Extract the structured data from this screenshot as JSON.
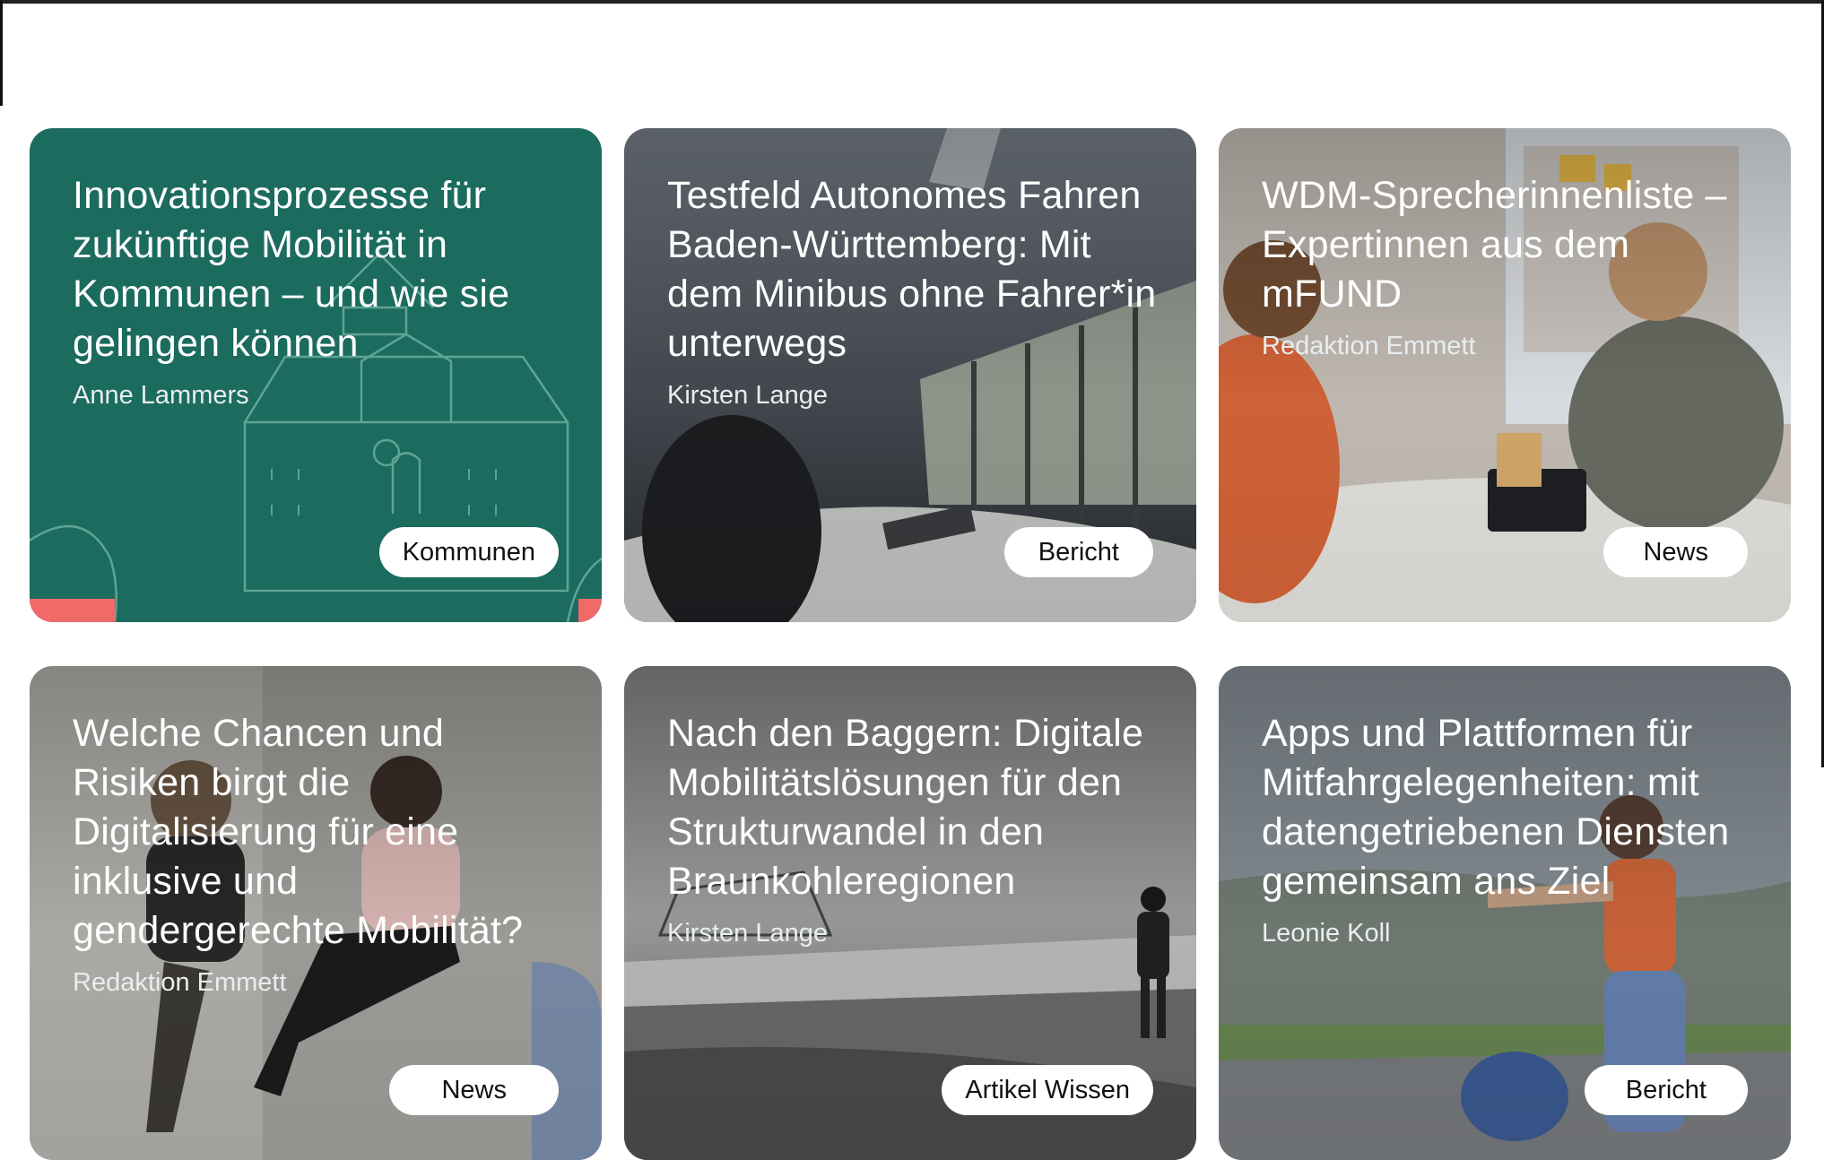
{
  "cards": [
    {
      "title": "Innovationsprozesse für zukünftige Mobilität in Kommunen – und wie sie gelingen können",
      "author": "Anne Lammers",
      "tag": "Kommunen",
      "bg": "#1c6b5f",
      "accent": "#f06a6a"
    },
    {
      "title": "Testfeld Autonomes Fahren Baden-Württemberg: Mit dem Minibus ohne Fahrer*in unterwegs",
      "author": "Kirsten Lange",
      "tag": "Bericht"
    },
    {
      "title": "WDM-Sprecherinnenliste – Expertinnen aus dem mFUND",
      "author": "Redaktion Emmett",
      "tag": "News"
    },
    {
      "title": "Welche Chancen und Risiken birgt die Digitalisierung für eine inklusive und gendergerechte Mobilität?",
      "author": "Redaktion Emmett",
      "tag": "News"
    },
    {
      "title": "Nach den Baggern: Digitale Mobilitätslösungen für den Strukturwandel in den Braunkohleregionen",
      "author": "Kirsten Lange",
      "tag": "Artikel Wissen"
    },
    {
      "title": "Apps und Plattformen für Mitfahrgelegenheiten: mit datengetriebenen Diensten gemeinsam ans Ziel",
      "author": "Leonie Koll",
      "tag": "Bericht"
    }
  ]
}
